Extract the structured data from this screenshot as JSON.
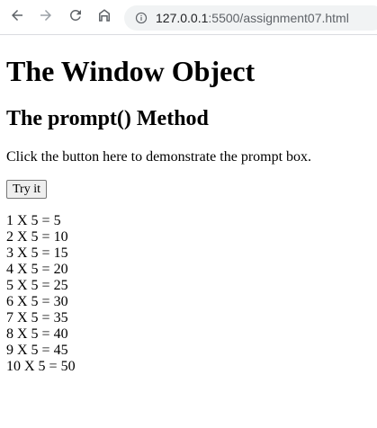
{
  "browser": {
    "url_host": "127.0.0.1",
    "url_path": ":5500/assignment07.html",
    "icons": {
      "back": "arrow-left",
      "forward": "arrow-right",
      "reload": "reload",
      "home": "home",
      "info": "info-circle"
    }
  },
  "page": {
    "heading": "The Window Object",
    "subheading": "The prompt() Method",
    "instruction": "Click the button here to demonstrate the prompt box.",
    "button_label": "Try it",
    "results": [
      "1 X 5 = 5",
      "2 X 5 = 10",
      "3 X 5 = 15",
      "4 X 5 = 20",
      "5 X 5 = 25",
      "6 X 5 = 30",
      "7 X 5 = 35",
      "8 X 5 = 40",
      "9 X 5 = 45",
      "10 X 5 = 50"
    ]
  }
}
